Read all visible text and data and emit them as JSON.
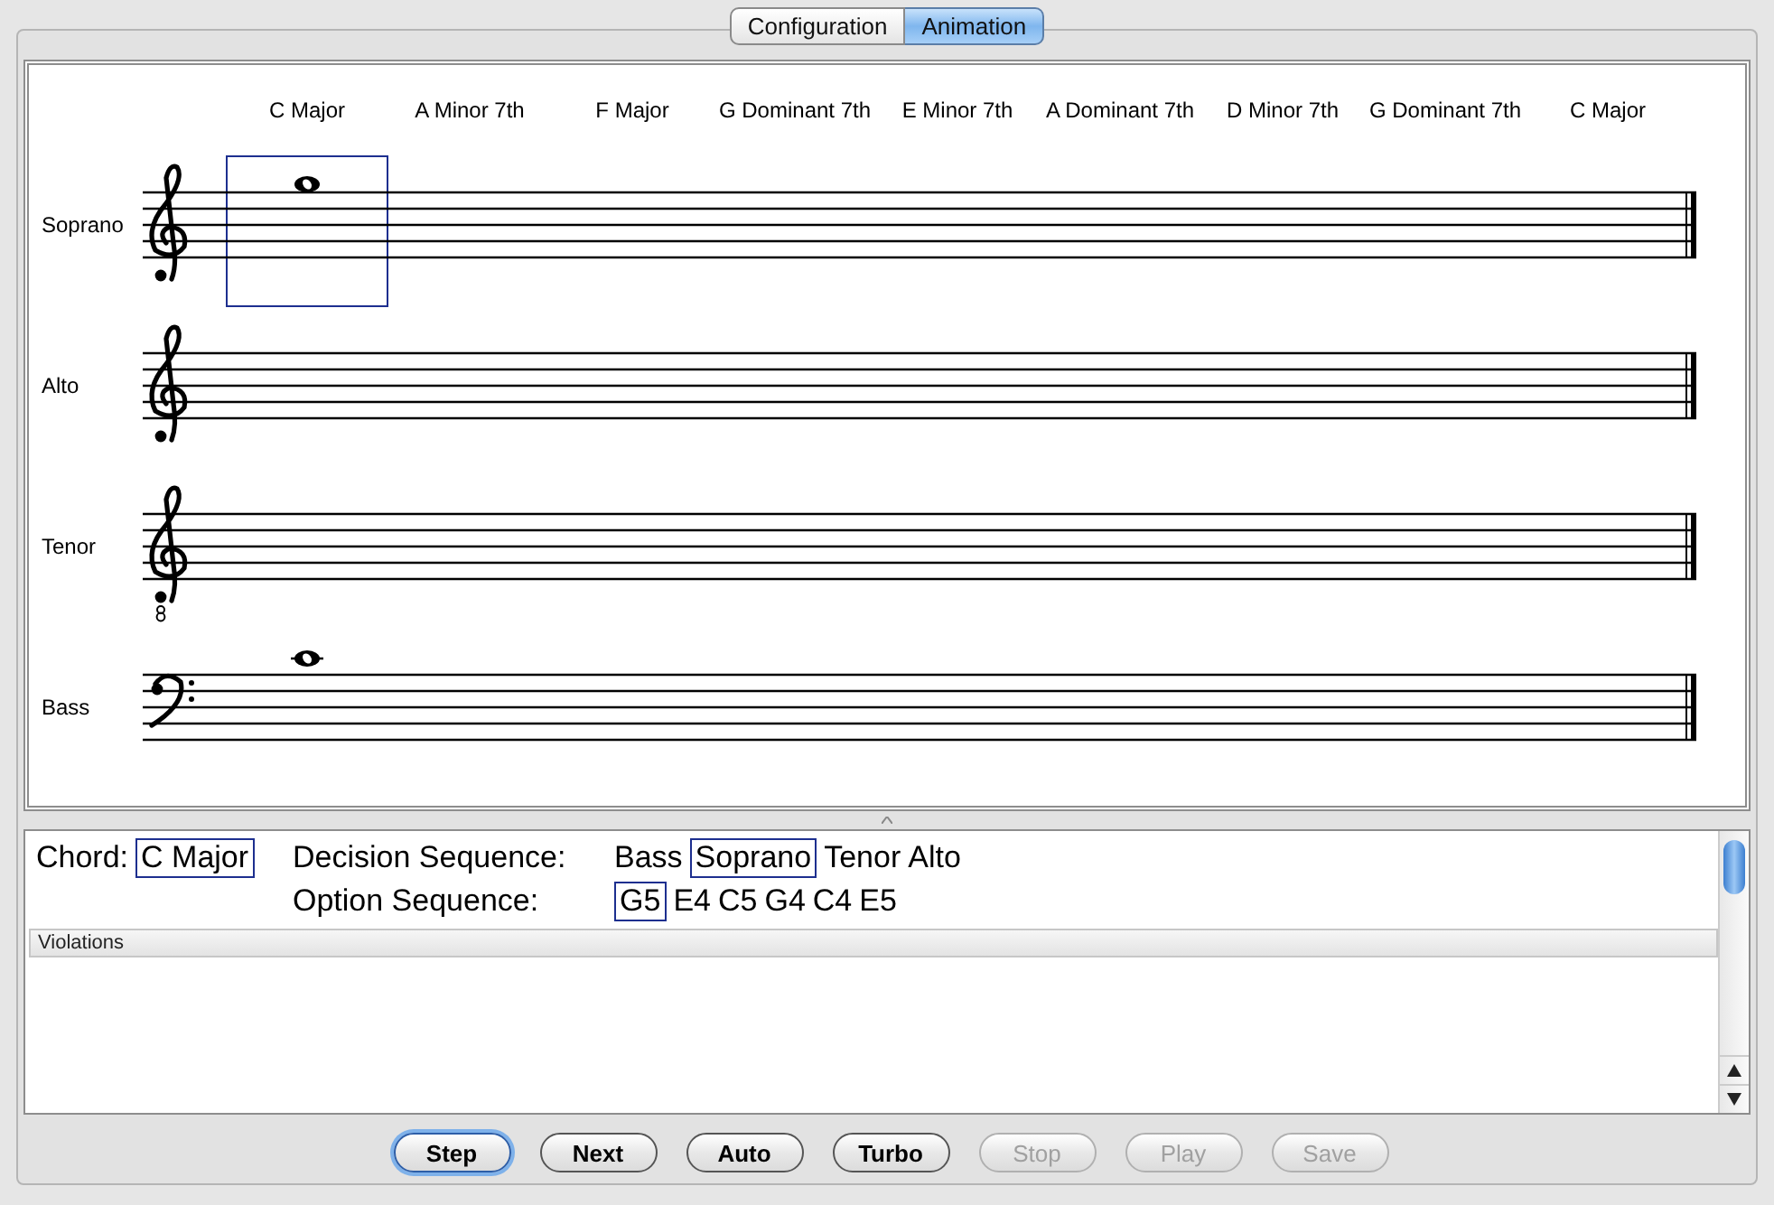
{
  "tabs": [
    {
      "label": "Configuration",
      "selected": false
    },
    {
      "label": "Animation",
      "selected": true
    }
  ],
  "score": {
    "chords": [
      {
        "label": "C Major",
        "selected": true
      },
      {
        "label": "A Minor 7th",
        "selected": false
      },
      {
        "label": "F Major",
        "selected": false
      },
      {
        "label": "G Dominant 7th",
        "selected": false
      },
      {
        "label": "E Minor 7th",
        "selected": false
      },
      {
        "label": "A Dominant 7th",
        "selected": false
      },
      {
        "label": "D Minor 7th",
        "selected": false
      },
      {
        "label": "G Dominant 7th",
        "selected": false
      },
      {
        "label": "C Major",
        "selected": false
      }
    ],
    "staves": [
      {
        "name": "Soprano",
        "kind": "treble",
        "note": {
          "kind": "space-above"
        }
      },
      {
        "name": "Alto",
        "kind": "treble"
      },
      {
        "name": "Tenor",
        "kind": "tenor"
      },
      {
        "name": "Bass",
        "kind": "bass",
        "note": {
          "kind": "ledger-above"
        }
      }
    ]
  },
  "info": {
    "chord_label": "Chord:",
    "chord": "C Major",
    "decision_label": "Decision Sequence:",
    "decision": [
      {
        "label": "Bass",
        "selected": false
      },
      {
        "label": "Soprano",
        "selected": true
      },
      {
        "label": "Tenor",
        "selected": false
      },
      {
        "label": "Alto",
        "selected": false
      }
    ],
    "option_label": "Option Sequence:",
    "options": [
      {
        "label": "G5",
        "selected": true
      },
      {
        "label": "E4",
        "selected": false
      },
      {
        "label": "C5",
        "selected": false
      },
      {
        "label": "G4",
        "selected": false
      },
      {
        "label": "C4",
        "selected": false
      },
      {
        "label": "E5",
        "selected": false
      }
    ],
    "violations": {
      "title": "Violations"
    }
  },
  "buttons": [
    {
      "label": "Step",
      "default": true,
      "disabled": false
    },
    {
      "label": "Next",
      "default": false,
      "disabled": false
    },
    {
      "label": "Auto",
      "default": false,
      "disabled": false
    },
    {
      "label": "Turbo",
      "default": false,
      "disabled": false
    },
    {
      "label": "Stop",
      "default": false,
      "disabled": true
    },
    {
      "label": "Play",
      "default": false,
      "disabled": true
    },
    {
      "label": "Save",
      "default": false,
      "disabled": true
    }
  ]
}
